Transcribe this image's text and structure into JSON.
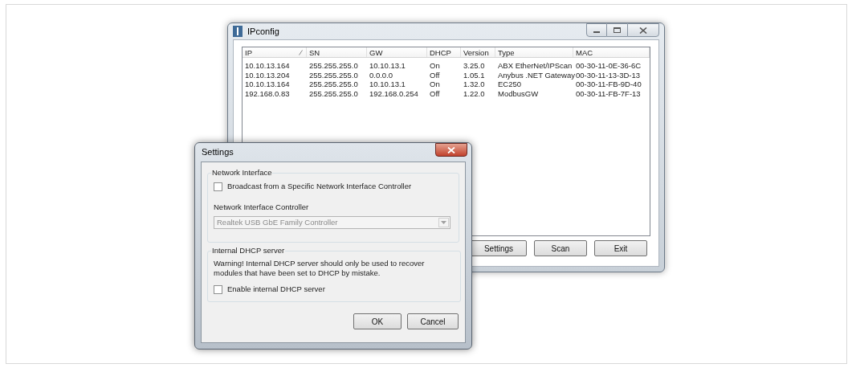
{
  "ipconfig": {
    "title": "IPconfig",
    "columns": [
      {
        "label": "IP",
        "sorted": true
      },
      {
        "label": "SN",
        "sorted": false
      },
      {
        "label": "GW",
        "sorted": false
      },
      {
        "label": "DHCP",
        "sorted": false
      },
      {
        "label": "Version",
        "sorted": false
      },
      {
        "label": "Type",
        "sorted": false
      },
      {
        "label": "MAC",
        "sorted": false
      }
    ],
    "rows": [
      [
        "10.10.13.164",
        "255.255.255.0",
        "10.10.13.1",
        "On",
        "3.25.0",
        "ABX EtherNet/IPScan",
        "00-30-11-0E-36-6C"
      ],
      [
        "10.10.13.204",
        "255.255.255.0",
        "0.0.0.0",
        "Off",
        "1.05.1",
        "Anybus .NET Gateway",
        "00-30-11-13-3D-13"
      ],
      [
        "10.10.13.164",
        "255.255.255.0",
        "10.10.13.1",
        "On",
        "1.32.0",
        "EC250",
        "00-30-11-FB-9D-40"
      ],
      [
        "192.168.0.83",
        "255.255.255.0",
        "192.168.0.254",
        "Off",
        "1.22.0",
        "ModbusGW",
        "00-30-11-FB-7F-13"
      ]
    ],
    "buttons": [
      "Settings",
      "Scan",
      "Exit"
    ]
  },
  "settings": {
    "title": "Settings",
    "network_interface": {
      "title": "Network Interface",
      "broadcast": {
        "label": "Broadcast from a Specific Network Interface Controller",
        "checked": false
      },
      "controller_label": "Network Interface Controller",
      "controller": {
        "value": "Realtek USB GbE Family Controller",
        "disabled": true
      }
    },
    "dhcp": {
      "title": "Internal DHCP server",
      "warning": "Warning! Internal DHCP server should only be used to recover modules that have been set to DHCP by mistake.",
      "enable": {
        "label": "Enable internal DHCP server",
        "checked": false
      }
    },
    "buttons": [
      "OK",
      "Cancel"
    ]
  }
}
